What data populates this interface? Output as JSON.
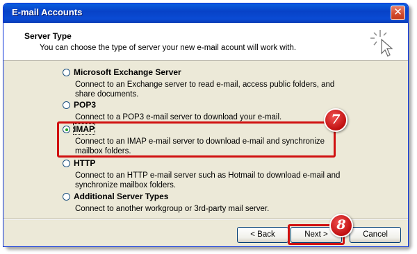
{
  "window": {
    "title": "E-mail Accounts",
    "close_icon": "close-icon"
  },
  "header": {
    "title": "Server Type",
    "subtitle": "You can choose the type of server your new e-mail acount will work with.",
    "icon": "wizard-sparkle-cursor-icon"
  },
  "options": [
    {
      "label": "Microsoft Exchange Server",
      "desc": "Connect to an Exchange server to read e-mail, access public folders, and share documents.",
      "selected": false
    },
    {
      "label": "POP3",
      "desc": "Connect to a POP3 e-mail server to download your e-mail.",
      "selected": false
    },
    {
      "label": "IMAP",
      "desc": "Connect to an IMAP e-mail server to download e-mail and synchronize mailbox folders.",
      "selected": true
    },
    {
      "label": "HTTP",
      "desc": "Connect to an HTTP e-mail server such as Hotmail to download e-mail and synchronize mailbox folders.",
      "selected": false
    },
    {
      "label": "Additional Server Types",
      "desc": "Connect to another workgroup or 3rd-party mail server.",
      "selected": false
    }
  ],
  "buttons": {
    "back": "< Back",
    "next": "Next >",
    "cancel": "Cancel"
  },
  "annotations": {
    "step7": "7",
    "step8": "8",
    "color": "#d01010"
  }
}
